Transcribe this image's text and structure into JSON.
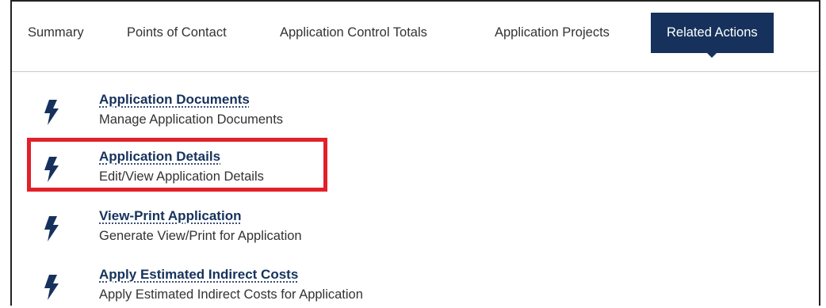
{
  "tabs": [
    {
      "label": "Summary"
    },
    {
      "label": "Points of Contact"
    },
    {
      "label": "Application Control Totals"
    },
    {
      "label": "Application Projects"
    },
    {
      "label": "Related Actions",
      "active": true
    }
  ],
  "actions": [
    {
      "title": "Application Documents",
      "description": "Manage Application Documents"
    },
    {
      "title": "Application Details",
      "description": "Edit/View Application Details",
      "highlighted": true
    },
    {
      "title": "View-Print Application",
      "description": "Generate View/Print for Application"
    },
    {
      "title": "Apply Estimated Indirect Costs",
      "description": "Apply Estimated Indirect Costs for Application"
    }
  ],
  "colors": {
    "accent": "#16325c",
    "highlight": "#e3202a",
    "text": "#333333"
  },
  "icons": {
    "action": "lightning-bolt-icon"
  }
}
